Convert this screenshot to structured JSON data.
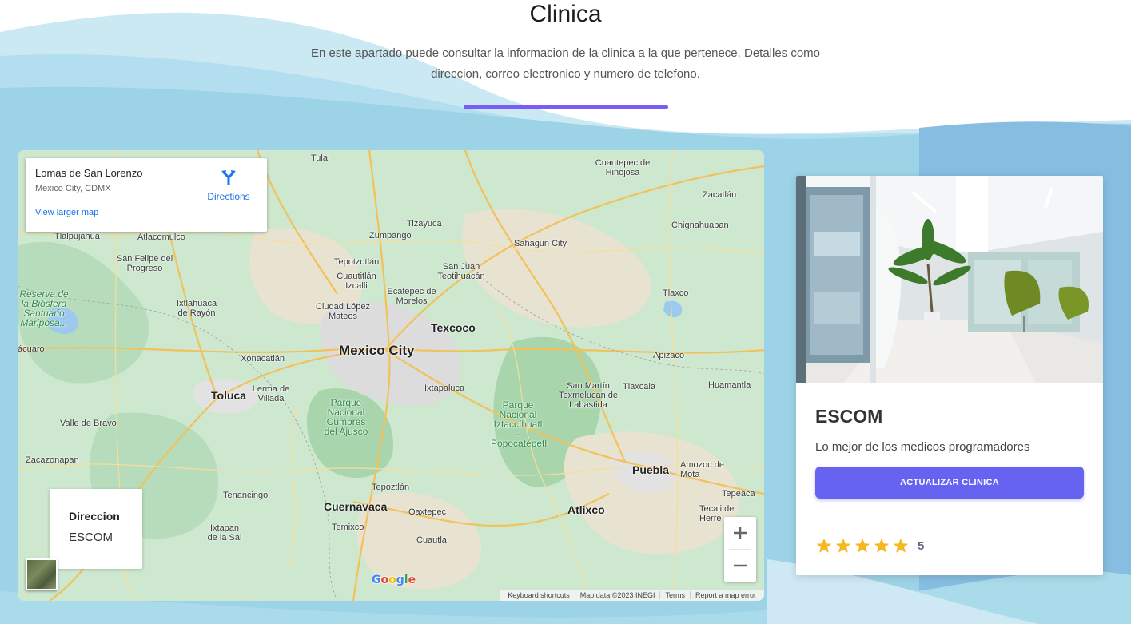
{
  "header": {
    "title": "Clinica",
    "subtitle": "En este apartado puede consultar la informacion de la clinica a la que pertenece. Detalles como direccion, correo electronico y numero de telefono."
  },
  "map": {
    "info_card": {
      "place_name": "Lomas de San Lorenzo",
      "place_region": "Mexico City, CDMX",
      "directions_label": "Directions",
      "larger_map_label": "View larger map"
    },
    "address_card": {
      "label": "Direccion",
      "value": "ESCOM"
    },
    "places": {
      "mexico_city": "Mexico City",
      "toluca": "Toluca",
      "texcoco": "Texcoco",
      "puebla": "Puebla",
      "cuernavaca": "Cuernavaca",
      "atlixco": "Atlixco",
      "tula": "Tula",
      "zumpango": "Zumpango",
      "tizayuca": "Tizayuca",
      "sahagun": "Sahagun City",
      "cuautepec": "Cuautepec de Hinojosa",
      "zacatlan": "Zacatlán",
      "chignahuapan": "Chignahuapan",
      "tlaxco": "Tlaxco",
      "apizaco": "Apizaco",
      "huamantla": "Huamantla",
      "tlaxcala": "Tlaxcala",
      "amozoc": "Amozoc de Mota",
      "tepeaca": "Tepeaca",
      "tecali": "Tecali de Herre",
      "san_martin": "San Martín Texmelucan de Labastida",
      "ixtapaluca": "Ixtapaluca",
      "tepoztlan": "Tepoztlán",
      "oaxtepec": "Oaxtepec",
      "cuautla": "Cuautla",
      "temixco": "Temixco",
      "tenancingo": "Tenancingo",
      "ixtapan": "Ixtapan de la Sal",
      "zacazonapan": "Zacazonapan",
      "valle_bravo": "Valle de Bravo",
      "lerma": "Lerma de Villada",
      "xonacatlan": "Xonacatlán",
      "ixtlahuaca": "Ixtlahuaca de Rayón",
      "san_felipe": "San Felipe del Progreso",
      "atlacomulco": "Atlacomulco",
      "tlalpujahua": "Tlalpujahua",
      "tepotzotlan": "Tepotzotlán",
      "cuautitlan": "Cuautitlán Izcalli",
      "ciudad_lopez": "Ciudad López Mateos",
      "ecatepec": "Ecatepec de Morelos",
      "san_juan": "San Juan Teotihuacán",
      "pn_cumbres": "Parque Nacional Cumbres del Ajusco",
      "pn_izta": "Parque Nacional Iztaccíhuatl - Popocatépetl",
      "biosfera": "Reserva de la Biósfera Santuario Mariposa...",
      "acuaro": "ácuaro"
    },
    "zoom_in_symbol": "+",
    "zoom_out_symbol": "−",
    "logo_text": "Google",
    "footer": {
      "shortcuts": "Keyboard shortcuts",
      "map_data": "Map data ©2023 INEGI",
      "terms": "Terms",
      "report": "Report a map error"
    }
  },
  "clinic": {
    "name": "ESCOM",
    "description": "Lo mejor de los medicos programadores",
    "update_button": "ACTUALIZAR CLINICA",
    "rating": 5,
    "rating_label": "5",
    "star_color": "#f6b81e"
  },
  "colors": {
    "accent": "#7b5cf5",
    "button": "#6663f1",
    "wave_light": "#cdeaf3",
    "wave_mid": "#9fd6e6",
    "wave_dark": "#7fb7de"
  }
}
